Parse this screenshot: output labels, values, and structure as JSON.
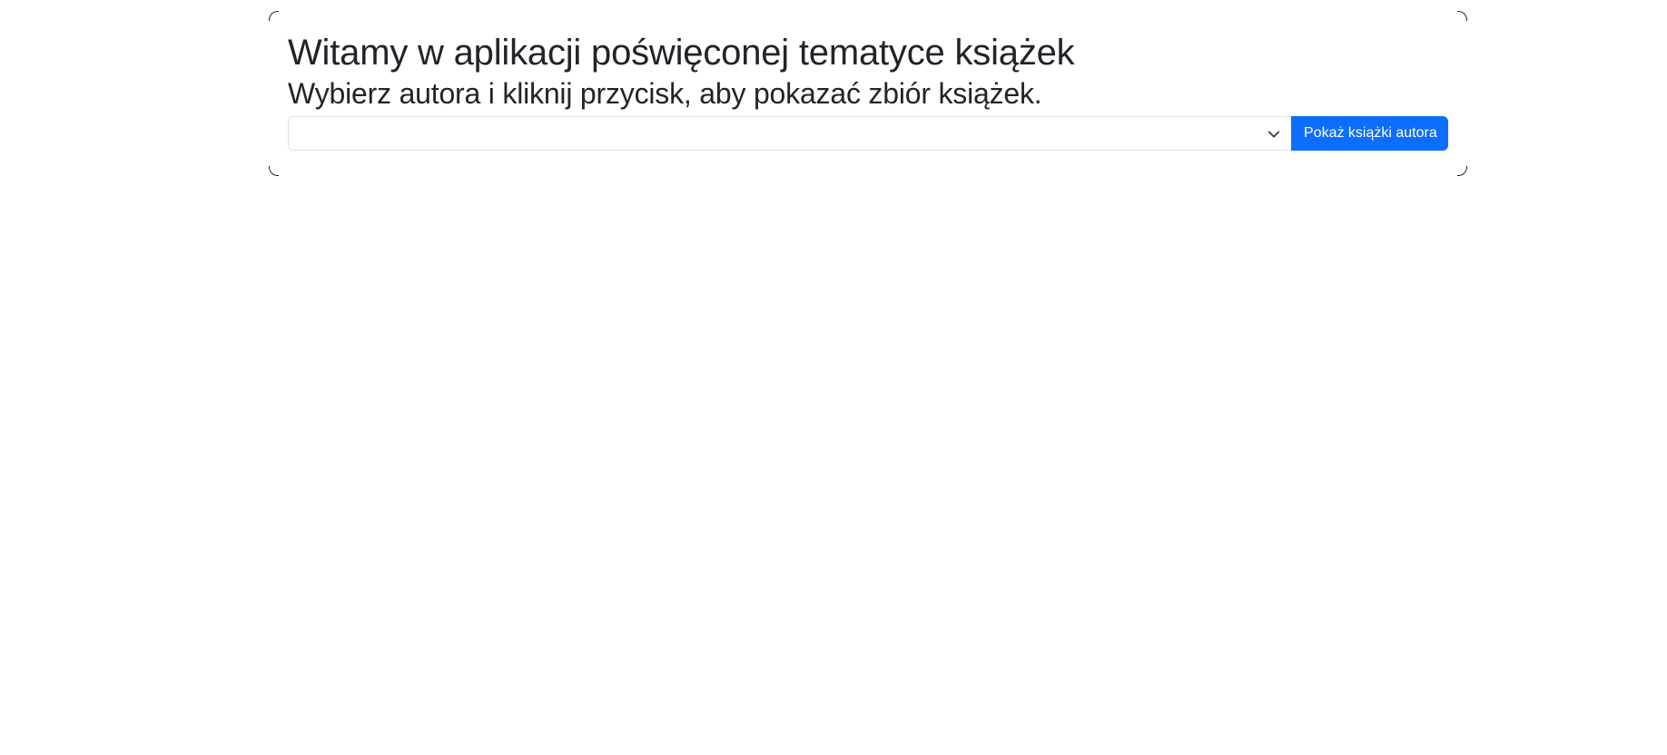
{
  "page": {
    "heading": "Witamy w aplikacji poświęconej tematyce książek",
    "subheading": "Wybierz autora i kliknij przycisk, aby pokazać zbiór książek."
  },
  "form": {
    "author_select": {
      "selected_value": "",
      "icon": "chevron-down-icon"
    },
    "submit_label": "Pokaż książki autora"
  },
  "colors": {
    "accent": "#0d6efd",
    "text": "#212529",
    "border": "#dee2e6"
  }
}
